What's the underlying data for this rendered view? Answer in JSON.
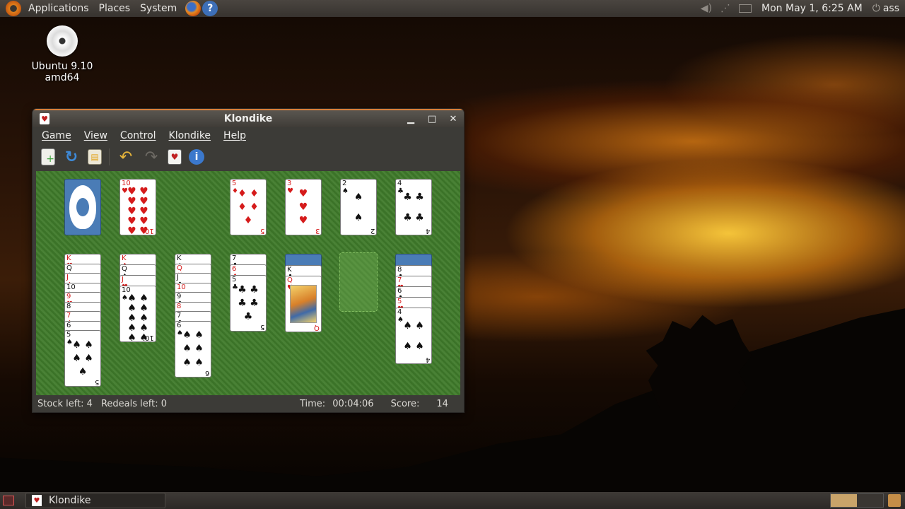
{
  "top_panel": {
    "menus": [
      "Applications",
      "Places",
      "System"
    ],
    "clock": "Mon May  1,  6:25 AM",
    "user": "ass"
  },
  "desktop": {
    "icons": [
      {
        "label": "Ubuntu 9.10 amd64",
        "icon": "cd-icon"
      }
    ]
  },
  "window": {
    "title": "Klondike",
    "menubar": [
      "Game",
      "View",
      "Control",
      "Klondike",
      "Help"
    ],
    "toolbar": [
      "new-game",
      "restart",
      "statistics",
      "undo",
      "redo",
      "deal",
      "about"
    ],
    "foundations": [
      {
        "rank": "5",
        "suit": "♦",
        "color": "red"
      },
      {
        "rank": "3",
        "suit": "♥",
        "color": "red"
      },
      {
        "rank": "2",
        "suit": "♠",
        "color": "black"
      },
      {
        "rank": "4",
        "suit": "♣",
        "color": "black"
      }
    ],
    "waste": {
      "rank": "10",
      "suit": "♥",
      "color": "red"
    },
    "tableau": [
      {
        "hidden": 0,
        "cards": [
          {
            "rank": "K",
            "suit": "♥",
            "color": "red"
          },
          {
            "rank": "Q",
            "suit": "♣",
            "color": "black"
          },
          {
            "rank": "J",
            "suit": "♦",
            "color": "red"
          },
          {
            "rank": "10",
            "suit": "♣",
            "color": "black"
          },
          {
            "rank": "9",
            "suit": "♥",
            "color": "red"
          },
          {
            "rank": "8",
            "suit": "♠",
            "color": "black"
          },
          {
            "rank": "7",
            "suit": "♦",
            "color": "red"
          },
          {
            "rank": "6",
            "suit": "♠",
            "color": "black"
          },
          {
            "rank": "5",
            "suit": "♠",
            "color": "black"
          }
        ]
      },
      {
        "hidden": 0,
        "cards": [
          {
            "rank": "K",
            "suit": "♦",
            "color": "red"
          },
          {
            "rank": "Q",
            "suit": "♠",
            "color": "black"
          },
          {
            "rank": "J",
            "suit": "♥",
            "color": "red"
          },
          {
            "rank": "10",
            "suit": "♠",
            "color": "black"
          }
        ]
      },
      {
        "hidden": 0,
        "cards": [
          {
            "rank": "K",
            "suit": "♠",
            "color": "black"
          },
          {
            "rank": "Q",
            "suit": "♥",
            "color": "red"
          },
          {
            "rank": "J",
            "suit": "♣",
            "color": "black"
          },
          {
            "rank": "10",
            "suit": "♥",
            "color": "red"
          },
          {
            "rank": "9",
            "suit": "♣",
            "color": "black"
          },
          {
            "rank": "8",
            "suit": "♥",
            "color": "red"
          },
          {
            "rank": "7",
            "suit": "♣",
            "color": "black"
          },
          {
            "rank": "6",
            "suit": "♠",
            "color": "black"
          }
        ]
      },
      {
        "hidden": 0,
        "cards": [
          {
            "rank": "7",
            "suit": "♣",
            "color": "black"
          },
          {
            "rank": "6",
            "suit": "♦",
            "color": "red"
          },
          {
            "rank": "5",
            "suit": "♣",
            "color": "black"
          }
        ]
      },
      {
        "hidden": 1,
        "cards": [
          {
            "rank": "K",
            "suit": "♣",
            "color": "black"
          },
          {
            "rank": "Q",
            "suit": "♥",
            "color": "red"
          }
        ]
      },
      {
        "hidden": 0,
        "cards": [],
        "empty": true
      },
      {
        "hidden": 1,
        "cards": [
          {
            "rank": "8",
            "suit": "♣",
            "color": "black"
          },
          {
            "rank": "7",
            "suit": "♥",
            "color": "red"
          },
          {
            "rank": "6",
            "suit": "♣",
            "color": "black"
          },
          {
            "rank": "5",
            "suit": "♥",
            "color": "red"
          },
          {
            "rank": "4",
            "suit": "♠",
            "color": "black"
          }
        ]
      }
    ],
    "status": {
      "stock_left": "Stock left: 4",
      "redeals_left": "Redeals left: 0",
      "time_label": "Time:",
      "time_value": "00:04:06",
      "score_label": "Score:",
      "score_value": "14"
    }
  },
  "bottom_panel": {
    "task": "Klondike"
  },
  "colors": {
    "felt": "#3f7a2a",
    "card_back": "#4a7cb6",
    "red_suit": "#d51b1b"
  }
}
